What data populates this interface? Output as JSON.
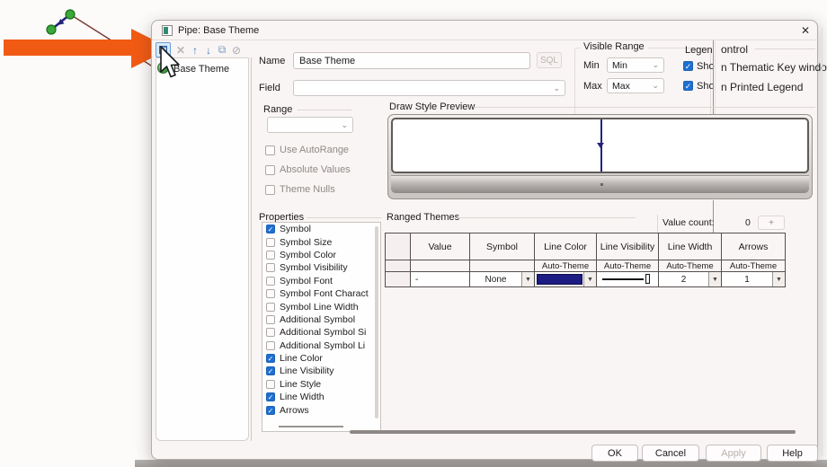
{
  "window": {
    "title": "Pipe: Base Theme",
    "close_glyph": "✕"
  },
  "toolbar": {
    "icons": [
      {
        "name": "new-theme-icon",
        "glyph": ""
      },
      {
        "name": "delete-icon",
        "glyph": "✕"
      },
      {
        "name": "move-up-icon",
        "glyph": "↑"
      },
      {
        "name": "move-down-icon",
        "glyph": "↓"
      },
      {
        "name": "duplicate-icon",
        "glyph": "⧉"
      },
      {
        "name": "disable-icon",
        "glyph": "⊘"
      }
    ]
  },
  "tree": {
    "root_item": "Base Theme"
  },
  "form": {
    "name_label": "Name",
    "name_value": "Base Theme",
    "sql_button": "SQL",
    "field_label": "Field",
    "field_value": ""
  },
  "visible_range": {
    "title": "Visible Range",
    "min_label": "Min",
    "min_value": "Min",
    "max_label": "Max",
    "max_value": "Max"
  },
  "legend_control": {
    "title_left_fragment": "Legen",
    "title_right_fragment": "ontrol",
    "left_checkbox_fragments": [
      "Sho",
      "Sho"
    ],
    "right_items": [
      "n Thematic Key window",
      "n Printed Legend"
    ]
  },
  "range_group": {
    "title": "Range",
    "dropdown_value": "",
    "checkboxes": [
      "Use AutoRange",
      "Absolute Values",
      "Theme Nulls"
    ]
  },
  "preview": {
    "title": "Draw Style Preview"
  },
  "properties": {
    "title": "Properties",
    "items": [
      {
        "label": "Symbol",
        "checked": true
      },
      {
        "label": "Symbol Size",
        "checked": false
      },
      {
        "label": "Symbol Color",
        "checked": false
      },
      {
        "label": "Symbol Visibility",
        "checked": false
      },
      {
        "label": "Symbol Font",
        "checked": false
      },
      {
        "label": "Symbol Font Charact",
        "checked": false
      },
      {
        "label": "Symbol Line Width",
        "checked": false
      },
      {
        "label": "Additional Symbol",
        "checked": false
      },
      {
        "label": "Additional Symbol Si",
        "checked": false
      },
      {
        "label": "Additional Symbol Li",
        "checked": false
      },
      {
        "label": "Line Color",
        "checked": true
      },
      {
        "label": "Line Visibility",
        "checked": true
      },
      {
        "label": "Line Style",
        "checked": false
      },
      {
        "label": "Line Width",
        "checked": true
      },
      {
        "label": "Arrows",
        "checked": true
      }
    ]
  },
  "ranged_themes": {
    "title": "Ranged Themes",
    "value_count_label": "Value count:",
    "value_count": "0",
    "add_button": "+",
    "columns": [
      "Value",
      "Symbol",
      "Line Color",
      "Line Visibility",
      "Line Width",
      "Arrows"
    ],
    "auto_theme": "Auto-Theme",
    "row": {
      "value": "-",
      "symbol": "None",
      "line_color": "#1c1c82",
      "line_width": "2",
      "arrows": "1"
    }
  },
  "footer": {
    "ok": "OK",
    "cancel": "Cancel",
    "apply": "Apply",
    "help": "Help"
  },
  "colors": {
    "accent_blue": "#1f6fd0",
    "navy_line": "#23237e",
    "orange_arrow": "#f15a13",
    "map_node_green": "#3aa83a",
    "map_link_maroon": "#7a3a34"
  }
}
